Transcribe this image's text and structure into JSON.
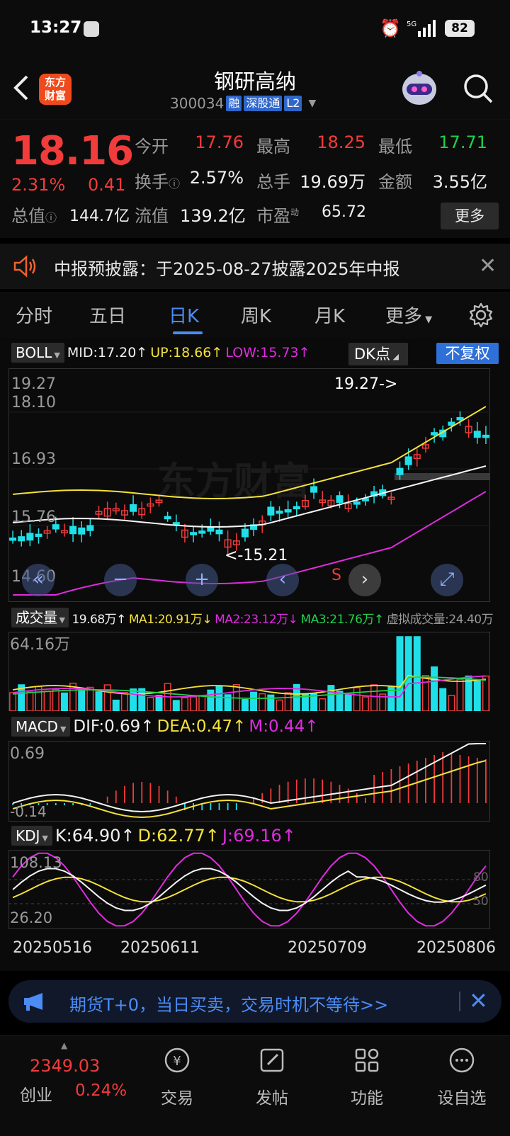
{
  "status": {
    "time": "13:27",
    "battery": "82",
    "network": "5G"
  },
  "header": {
    "name": "钢研高纳",
    "code": "300034",
    "tag_rong": "融",
    "tag_sgt": "深股通",
    "tag_l2": "L2",
    "logo_line1": "东方",
    "logo_line2": "财富"
  },
  "quote": {
    "price": "18.16",
    "pct": "2.31%",
    "chg": "0.41",
    "open_label": "今开",
    "open": "17.76",
    "high_label": "最高",
    "high": "18.25",
    "low_label": "最低",
    "low": "17.71",
    "turnover_label": "换手",
    "turnover": "2.57%",
    "volume_label": "总手",
    "volume": "19.69万",
    "amount_label": "金额",
    "amount": "3.55亿",
    "mktcap_label": "总值",
    "mktcap": "144.7亿",
    "float_label": "流值",
    "float": "139.2亿",
    "pe_label": "市盈",
    "pe_sup": "动",
    "pe": "65.72",
    "more": "更多"
  },
  "notice": {
    "text": "中报预披露：于2025-08-27披露2025年中报"
  },
  "tabs": [
    "分时",
    "五日",
    "日K",
    "周K",
    "月K",
    "更多"
  ],
  "boll": {
    "sel": "BOLL",
    "mid": "MID:17.20↑",
    "up": "UP:18.66↑",
    "low": "LOW:15.73↑",
    "dk": "DK点",
    "adj": "不复权"
  },
  "kchart": {
    "y_labels": [
      "19.27",
      "18.10",
      "16.93",
      "15.76",
      "14.60"
    ],
    "max_mark": "19.27->",
    "min_mark": "<-15.21",
    "signal": "S",
    "watermark": "东方财富"
  },
  "vol": {
    "sel": "成交量",
    "v": "19.68万↑",
    "ma1": "MA1:20.91万↓",
    "ma2": "MA2:23.12万↓",
    "ma3": "MA3:21.76万↑",
    "virt": "虚拟成交量:24.40万",
    "y_label": "64.16万"
  },
  "macd": {
    "sel": "MACD",
    "dif": "DIF:0.69↑",
    "dea": "DEA:0.47↑",
    "m": "M:0.44↑",
    "y_top": "0.69",
    "y_bot": "-0.14"
  },
  "kdj": {
    "sel": "KDJ",
    "k": "K:64.90↑",
    "d": "D:62.77↑",
    "j": "J:69.16↑",
    "y_top": "108.13",
    "y_bot": "26.20",
    "r80": "80",
    "r50": "50"
  },
  "dates": [
    "20250516",
    "20250611",
    "20250709",
    "20250806"
  ],
  "banner": {
    "text": "期货T+0，当日买卖，交易时机不等待>>"
  },
  "bottom": {
    "idx_val": "2349.03",
    "idx_name": "创业",
    "idx_pct": "0.24%",
    "nav": [
      "交易",
      "发帖",
      "功能",
      "设自选"
    ]
  },
  "colors": {
    "up": "#f23b3b",
    "down": "#1fe0e8",
    "yellow": "#f5e23a",
    "magenta": "#e02be0",
    "accent": "#4b8cf5"
  }
}
